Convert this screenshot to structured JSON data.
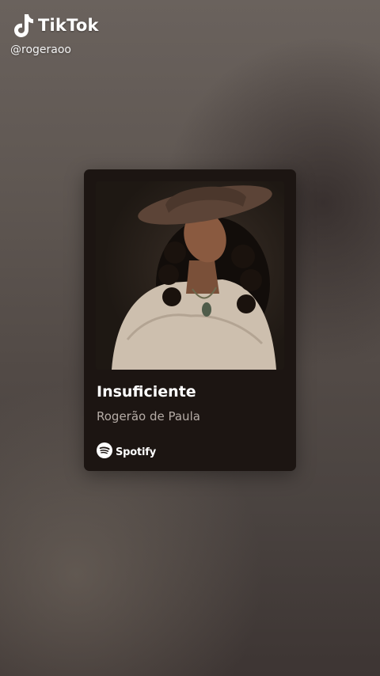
{
  "watermark": {
    "brand": "TikTok",
    "handle": "@rogeraoo",
    "icon": "tiktok-note-icon"
  },
  "card": {
    "title": "Insuficiente",
    "artist": "Rogerão de Paula",
    "provider": "Spotify",
    "provider_icon": "spotify-icon",
    "cover_art": "album-cover-photo"
  },
  "colors": {
    "card_bg": "#1c1512",
    "title": "#ffffff",
    "artist": "#b5aca6"
  }
}
